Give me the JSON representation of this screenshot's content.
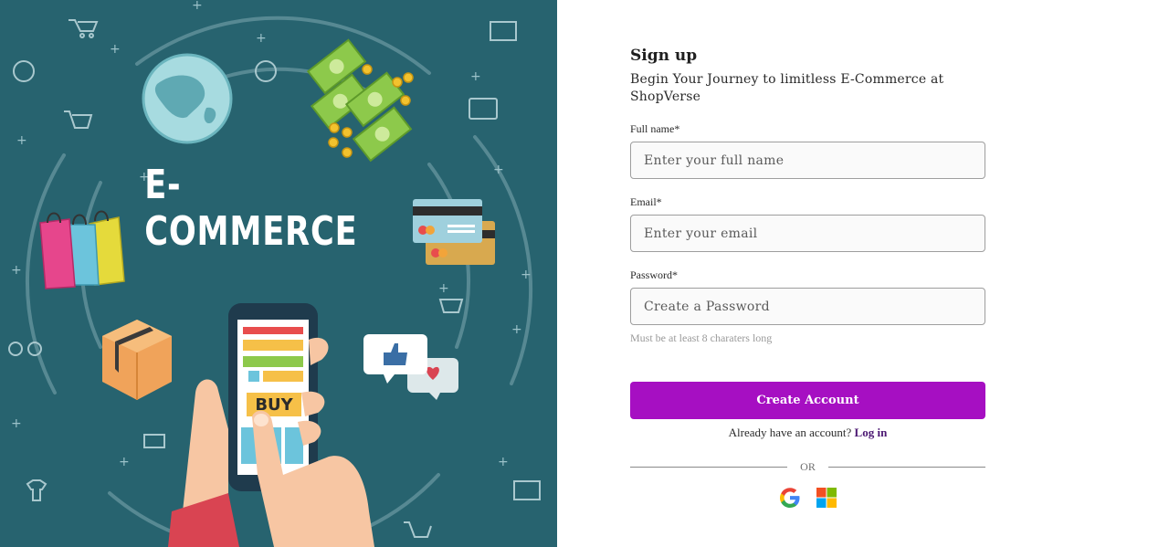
{
  "hero": {
    "word": "E-COMMERCE",
    "buy_label": "BUY"
  },
  "signup": {
    "title": "Sign up",
    "subtitle": "Begin Your Journey to limitless E-Commerce at ShopVerse",
    "fields": [
      {
        "label": "Full name*",
        "placeholder": "Enter your full name",
        "value": ""
      },
      {
        "label": "Email*",
        "placeholder": "Enter your email",
        "value": ""
      },
      {
        "label": "Password*",
        "placeholder": "Create a Password",
        "value": ""
      }
    ],
    "password_hint": "Must be at least 8 charaters long",
    "create_label": "Create Account",
    "login_prompt": "Already have an account?",
    "login_link": "Log in",
    "divider": "OR"
  },
  "colors": {
    "hero_bg": "#27636f",
    "primary": "#a60fc2",
    "link": "#4b1772"
  },
  "icons": [
    "google-icon",
    "microsoft-icon"
  ]
}
